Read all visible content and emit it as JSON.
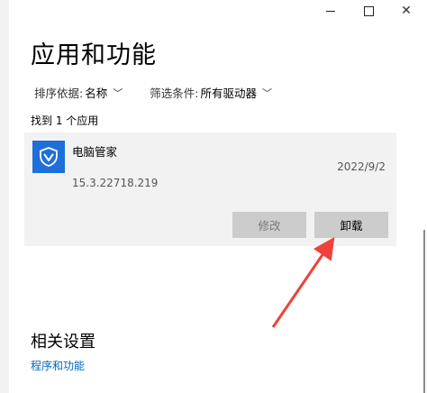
{
  "window": {
    "minimize_glyph": "—",
    "maximize_glyph": "□",
    "close_glyph": "✕"
  },
  "page": {
    "title": "应用和功能"
  },
  "filters": {
    "sort_label": "排序依据:",
    "sort_value": "名称",
    "filter_label": "筛选条件:",
    "filter_value": "所有驱动器"
  },
  "results": {
    "count_text": "找到 1 个应用"
  },
  "app": {
    "name": "电脑管家",
    "date": "2022/9/2",
    "version": "15.3.22718.219",
    "icon": "shield-icon",
    "icon_color": "#1e6fd9"
  },
  "buttons": {
    "modify": "修改",
    "uninstall": "卸载"
  },
  "related": {
    "heading": "相关设置",
    "link": "程序和功能"
  },
  "annotation": {
    "arrow_color": "#f0413a"
  }
}
